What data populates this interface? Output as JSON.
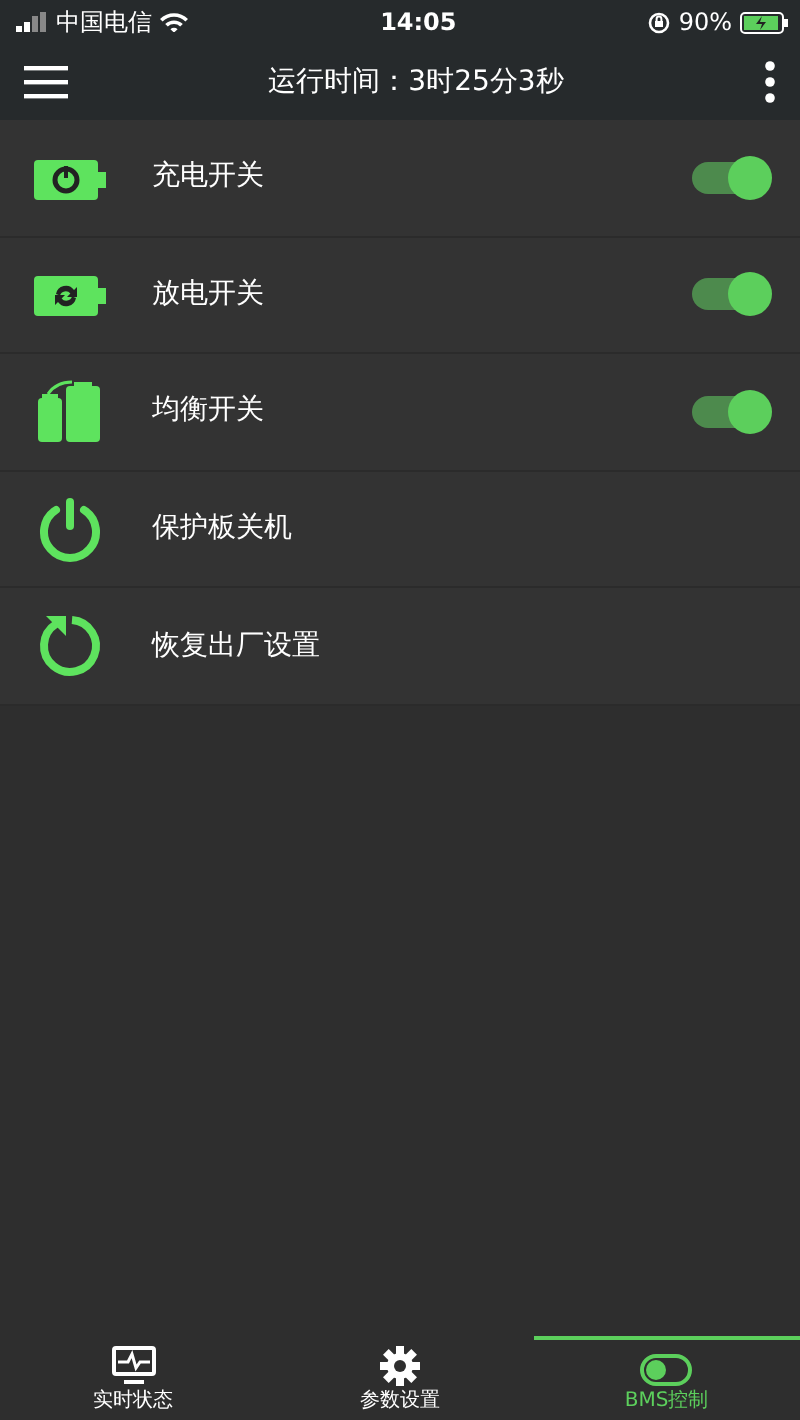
{
  "status_bar": {
    "carrier": "中国电信",
    "time": "14:05",
    "battery": "90%"
  },
  "header": {
    "title": "运行时间：3时25分3秒"
  },
  "items": [
    {
      "label": "充电开关",
      "kind": "toggle",
      "on": true
    },
    {
      "label": "放电开关",
      "kind": "toggle",
      "on": true
    },
    {
      "label": "均衡开关",
      "kind": "toggle",
      "on": true
    },
    {
      "label": "保护板关机",
      "kind": "action"
    },
    {
      "label": "恢复出厂设置",
      "kind": "action"
    }
  ],
  "tabs": [
    {
      "label": "实时状态",
      "selected": false
    },
    {
      "label": "参数设置",
      "selected": false
    },
    {
      "label": "BMS控制",
      "selected": true
    }
  ]
}
